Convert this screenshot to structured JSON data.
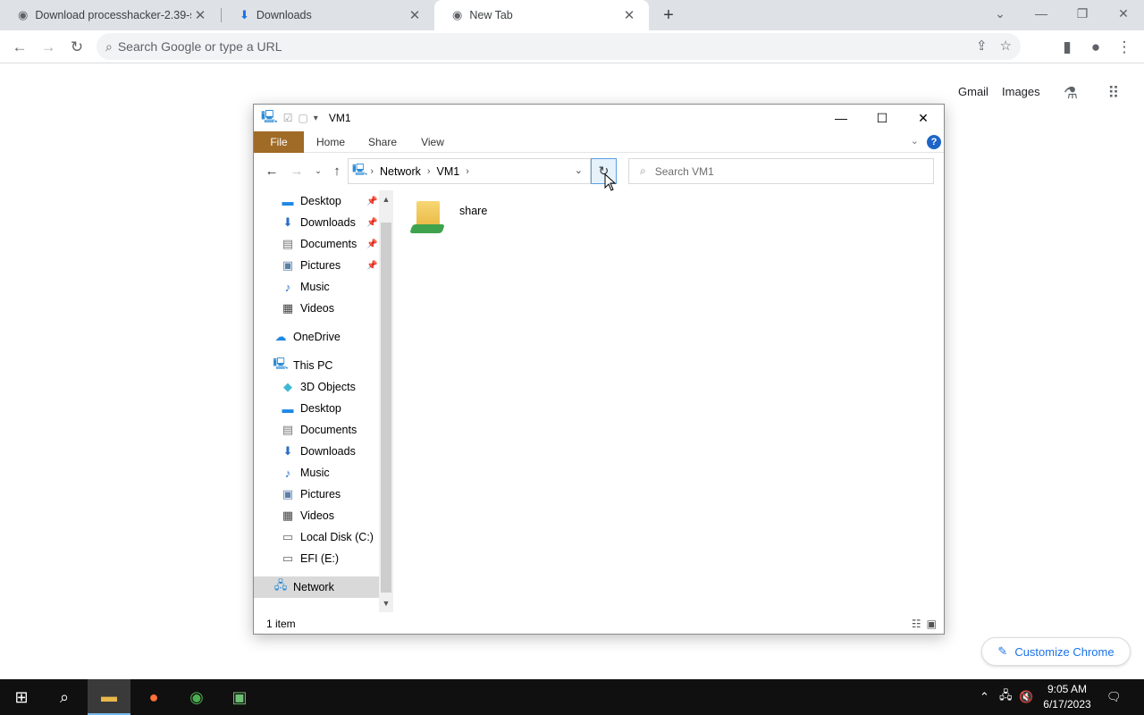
{
  "browser": {
    "tabs": [
      {
        "label": "Download processhacker-2.39-se",
        "icon": "chrome-icon"
      },
      {
        "label": "Downloads",
        "icon": "download-icon"
      },
      {
        "label": "New Tab",
        "icon": "chrome-icon",
        "active": true
      }
    ],
    "omnibox_placeholder": "Search Google or type a URL",
    "ntp": {
      "gmail": "Gmail",
      "images": "Images",
      "customize": "Customize Chrome"
    }
  },
  "explorer": {
    "title": "VM1",
    "ribbon_tabs": [
      "File",
      "Home",
      "Share",
      "View"
    ],
    "help": "?",
    "breadcrumb": [
      "Network",
      "VM1"
    ],
    "search_placeholder": "Search VM1",
    "nav": {
      "quick_access": [
        {
          "label": "Desktop",
          "pinned": true
        },
        {
          "label": "Downloads",
          "pinned": true
        },
        {
          "label": "Documents",
          "pinned": true
        },
        {
          "label": "Pictures",
          "pinned": true
        },
        {
          "label": "Music"
        },
        {
          "label": "Videos"
        }
      ],
      "onedrive": "OneDrive",
      "this_pc": "This PC",
      "this_pc_items": [
        "3D Objects",
        "Desktop",
        "Documents",
        "Downloads",
        "Music",
        "Pictures",
        "Videos",
        "Local Disk (C:)",
        "EFI (E:)"
      ],
      "network": "Network"
    },
    "items": [
      {
        "name": "share"
      }
    ],
    "status": "1 item"
  },
  "taskbar": {
    "time": "9:05 AM",
    "date": "6/17/2023"
  }
}
